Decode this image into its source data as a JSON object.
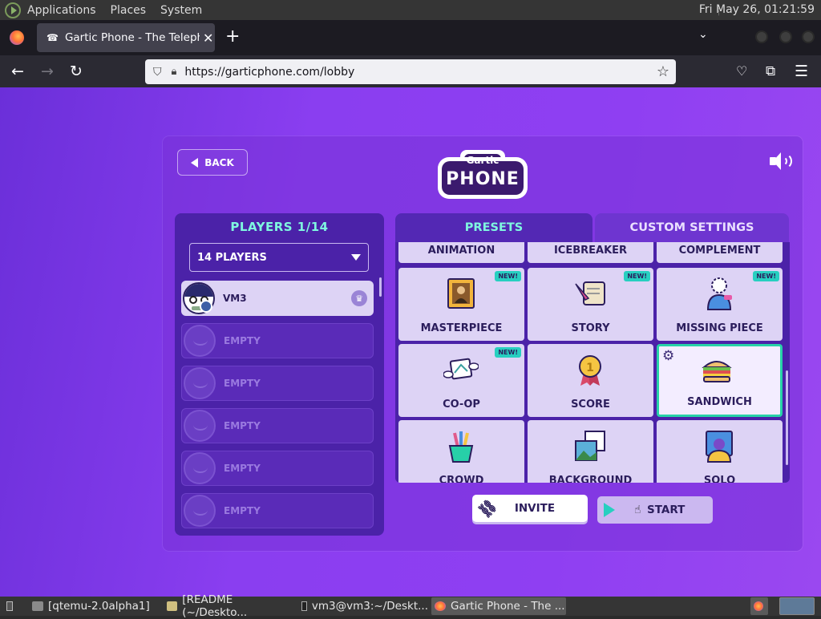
{
  "topbar": {
    "menus": [
      "Applications",
      "Places",
      "System"
    ],
    "clock": "Fri May 26, 01:21:59"
  },
  "browser": {
    "tab_title": "Gartic Phone - The Telephone",
    "url": "https://garticphone.com/lobby"
  },
  "lobby": {
    "back_label": "BACK",
    "logo": {
      "line1": "Gartic",
      "line2": "PHONE"
    },
    "players_header": "PLAYERS 1/14",
    "players_select": "14 PLAYERS",
    "players": [
      {
        "name": "VM3",
        "host": true
      },
      {
        "name": "EMPTY"
      },
      {
        "name": "EMPTY"
      },
      {
        "name": "EMPTY"
      },
      {
        "name": "EMPTY"
      },
      {
        "name": "EMPTY"
      }
    ],
    "tabs": {
      "presets": "PRESETS",
      "custom": "CUSTOM SETTINGS"
    },
    "modes": [
      {
        "label": "ANIMATION"
      },
      {
        "label": "ICEBREAKER"
      },
      {
        "label": "COMPLEMENT"
      },
      {
        "label": "MASTERPIECE",
        "badge": "NEW!"
      },
      {
        "label": "STORY",
        "badge": "NEW!"
      },
      {
        "label": "MISSING PIECE",
        "badge": "NEW!"
      },
      {
        "label": "CO-OP",
        "badge": "NEW!"
      },
      {
        "label": "SCORE"
      },
      {
        "label": "SANDWICH",
        "selected": true
      },
      {
        "label": "CROWD"
      },
      {
        "label": "BACKGROUND"
      },
      {
        "label": "SOLO"
      }
    ],
    "invite_label": "INVITE",
    "start_label": "START"
  },
  "taskbar": {
    "items": [
      "[qtemu-2.0alpha1]",
      "[README (~/Deskto...",
      "vm3@vm3:~/Deskt...",
      "Gartic Phone - The ..."
    ]
  },
  "colors": {
    "accent_teal": "#7ff7e0",
    "panel_purple": "#4b22a8",
    "background_purple": "#8a3ef0",
    "selected_border": "#27d2a8"
  }
}
